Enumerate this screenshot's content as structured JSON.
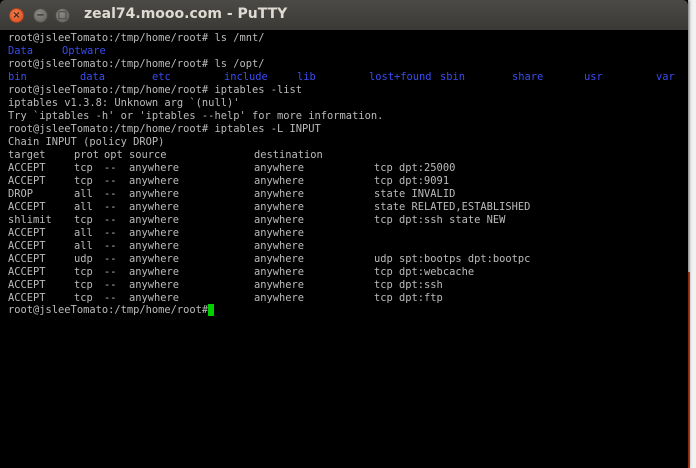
{
  "window": {
    "title": "zeal74.mooo.com - PuTTY",
    "buttons": {
      "close": "×",
      "minimize": "−",
      "maximize": "□"
    }
  },
  "colors": {
    "terminal_bg": "#000000",
    "terminal_fg": "#bbbbbb",
    "directory_fg": "#3a4cf0",
    "cursor": "#00d000"
  },
  "terminal": {
    "lines": [
      "root@jsleeTomato:/tmp/home/root# ls /mnt/",
      "",
      "root@jsleeTomato:/tmp/home/root# ls /opt/",
      "",
      "root@jsleeTomato:/tmp/home/root# iptables -list",
      "iptables v1.3.8: Unknown arg `(null)'",
      "Try `iptables -h' or 'iptables --help' for more information.",
      "root@jsleeTomato:/tmp/home/root# iptables -L INPUT",
      "Chain INPUT (policy DROP)"
    ],
    "mnt_listing": [
      "Data",
      "Optware"
    ],
    "opt_listing": [
      "bin",
      "data",
      "etc",
      "include",
      "lib",
      "lost+found",
      "sbin",
      "share",
      "usr",
      "var"
    ],
    "table_header": [
      "target",
      "prot",
      "opt",
      "source",
      "destination",
      ""
    ],
    "table_rows": [
      [
        "ACCEPT",
        "tcp",
        "--",
        "anywhere",
        "anywhere",
        "tcp dpt:25000"
      ],
      [
        "ACCEPT",
        "tcp",
        "--",
        "anywhere",
        "anywhere",
        "tcp dpt:9091"
      ],
      [
        "DROP",
        "all",
        "--",
        "anywhere",
        "anywhere",
        "state INVALID"
      ],
      [
        "ACCEPT",
        "all",
        "--",
        "anywhere",
        "anywhere",
        "state RELATED,ESTABLISHED"
      ],
      [
        "shlimit",
        "tcp",
        "--",
        "anywhere",
        "anywhere",
        "tcp dpt:ssh state NEW"
      ],
      [
        "ACCEPT",
        "all",
        "--",
        "anywhere",
        "anywhere",
        ""
      ],
      [
        "ACCEPT",
        "all",
        "--",
        "anywhere",
        "anywhere",
        ""
      ],
      [
        "ACCEPT",
        "udp",
        "--",
        "anywhere",
        "anywhere",
        "udp spt:bootps dpt:bootpc"
      ],
      [
        "ACCEPT",
        "tcp",
        "--",
        "anywhere",
        "anywhere",
        "tcp dpt:webcache"
      ],
      [
        "ACCEPT",
        "tcp",
        "--",
        "anywhere",
        "anywhere",
        "tcp dpt:ssh"
      ],
      [
        "ACCEPT",
        "tcp",
        "--",
        "anywhere",
        "anywhere",
        "tcp dpt:ftp"
      ]
    ],
    "prompt": "root@jsleeTomato:/tmp/home/root# "
  }
}
